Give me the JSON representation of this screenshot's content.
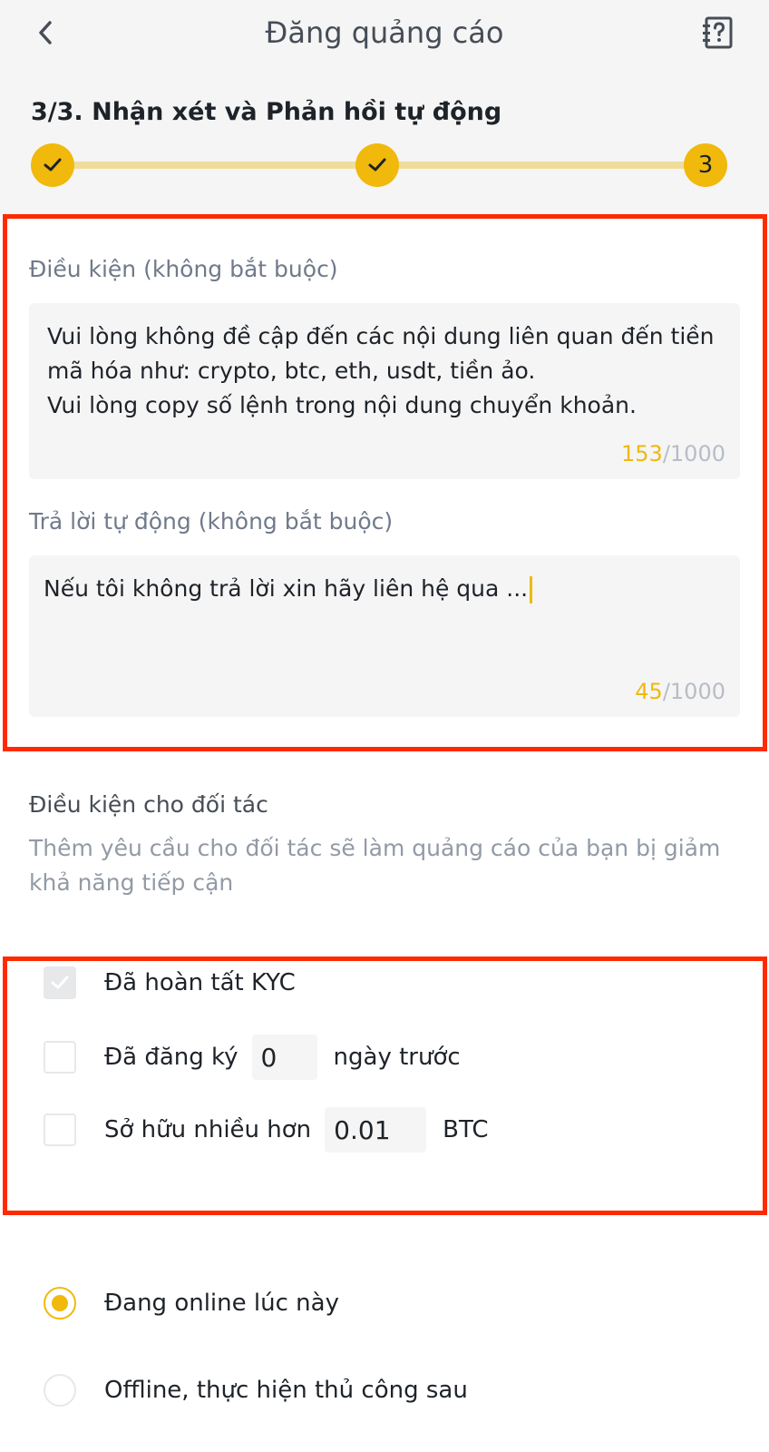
{
  "header": {
    "title": "Đăng quảng cáo"
  },
  "stepper": {
    "title": "3/3. Nhận xét và Phản hồi tự động",
    "current_step": "3",
    "completed_steps": 2,
    "accent": "#f0b90b"
  },
  "terms": {
    "label": "Điều kiện (không bắt buộc)",
    "value": "Vui lòng không đề cập đến các nội dung liên quan đến tiền\nmã hóa như: crypto, btc, eth, usdt, tiền ảo.\nVui lòng copy số lệnh trong nội dung chuyển khoản.",
    "count": "153",
    "max": "/1000"
  },
  "auto_reply": {
    "label": "Trả lời tự động (không bắt buộc)",
    "value": "Nếu tôi không trả lời xin hãy liên hệ qua ...",
    "count": "45",
    "max": "/1000"
  },
  "partner": {
    "title": "Điều kiện cho đối tác",
    "description": "Thêm yêu cầu cho đối tác sẽ làm quảng cáo của bạn bị giảm khả năng tiếp cận",
    "kyc": {
      "label": "Đã hoàn tất KYC",
      "checked": true
    },
    "registered": {
      "label": "Đã đăng ký",
      "value": "0",
      "unit": "ngày trước",
      "checked": false
    },
    "holdings": {
      "label": "Sở hữu nhiều hơn",
      "value": "0.01",
      "unit": "BTC",
      "checked": false
    }
  },
  "status": {
    "online_label": "Đang online lúc này",
    "offline_label": "Offline, thực hiện thủ công sau",
    "selected": "online"
  },
  "icons": [
    "back-icon",
    "help-icon",
    "check-icon"
  ],
  "colors": {
    "accent": "#f0b90b",
    "highlight": "#ff2a00"
  }
}
